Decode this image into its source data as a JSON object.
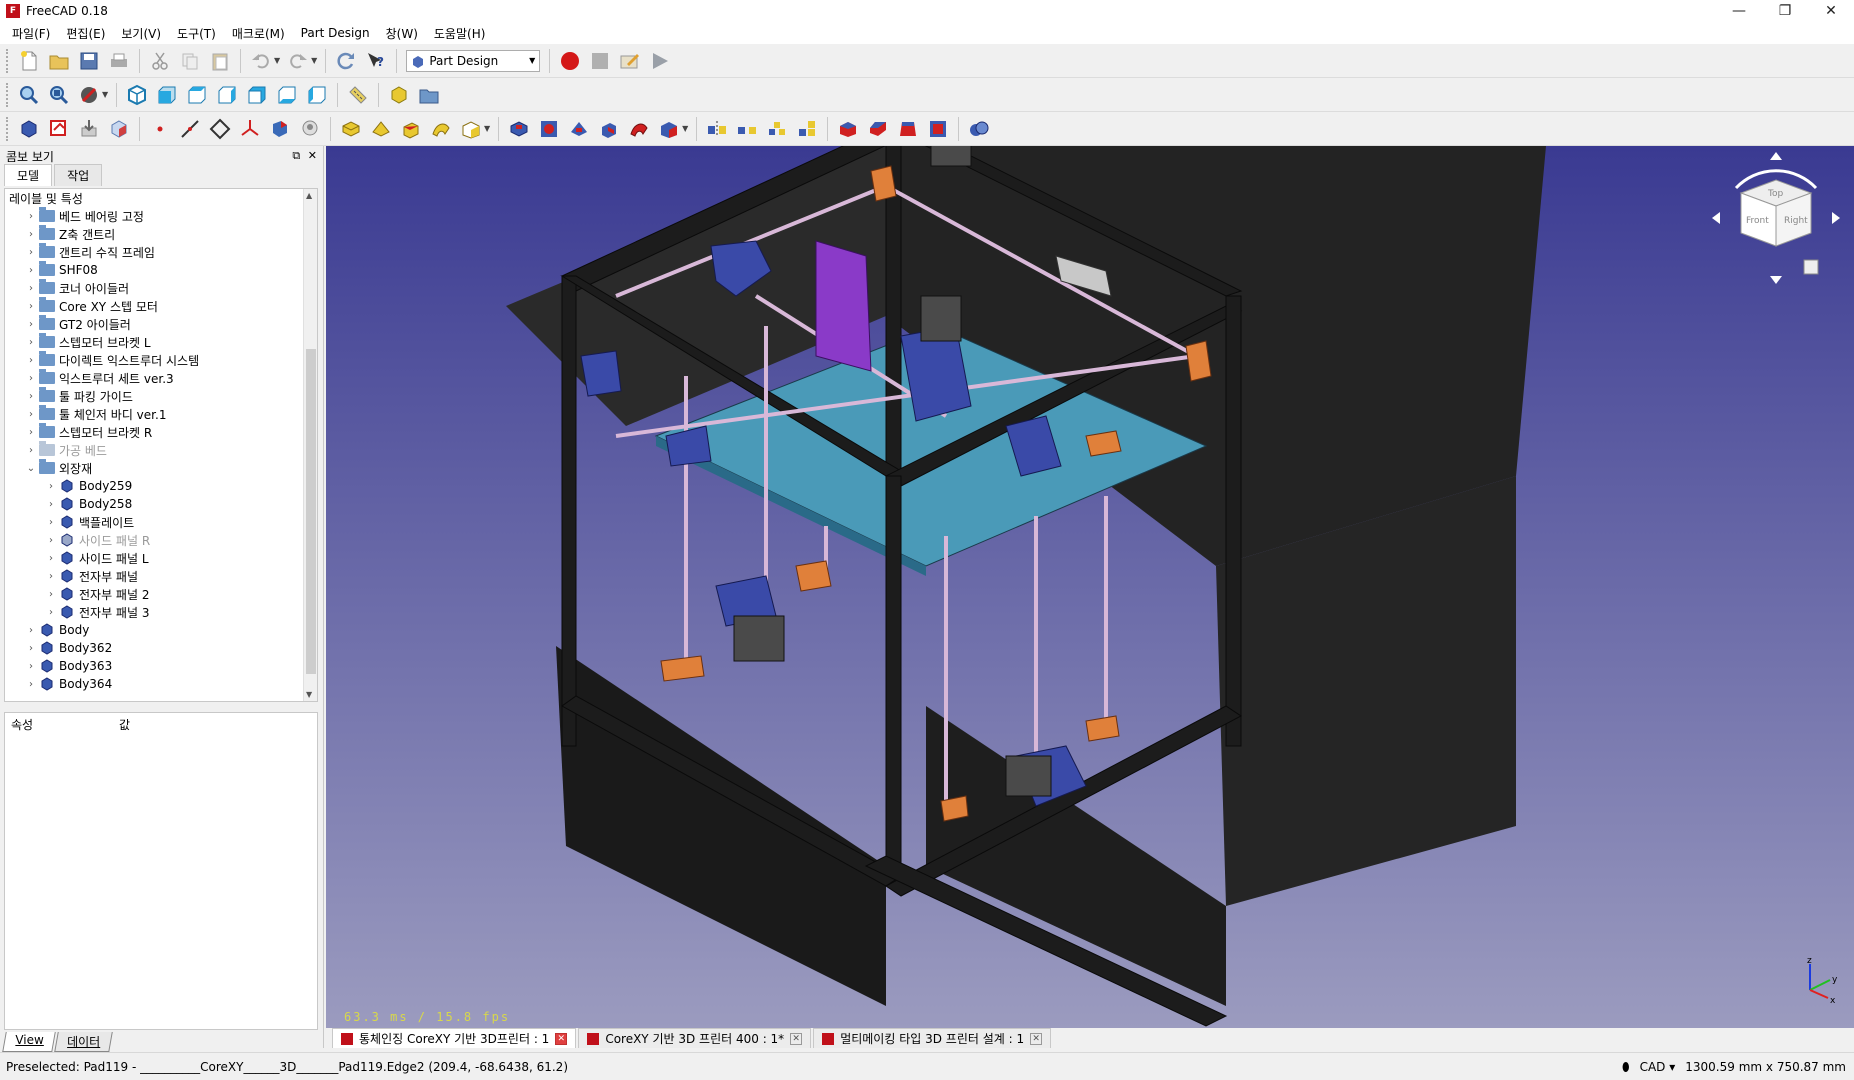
{
  "window": {
    "title": "FreeCAD 0.18",
    "minimize": "—",
    "restore": "❐",
    "close": "✕"
  },
  "menu": [
    "파일(F)",
    "편집(E)",
    "보기(V)",
    "도구(T)",
    "매크로(M)",
    "Part Design",
    "창(W)",
    "도움말(H)"
  ],
  "workbench": {
    "selected": "Part Design"
  },
  "combo": {
    "title": "콤보 보기",
    "tabs": [
      "모델",
      "작업"
    ],
    "tree_header": "레이블 및 특성",
    "items": [
      {
        "label": "베드 베어링 고정",
        "type": "folder",
        "expanded": false,
        "dim": false
      },
      {
        "label": "Z축 갠트리",
        "type": "folder",
        "expanded": false,
        "dim": false
      },
      {
        "label": "갠트리 수직 프레임",
        "type": "folder",
        "expanded": false,
        "dim": false
      },
      {
        "label": "SHF08",
        "type": "folder",
        "expanded": false,
        "dim": false
      },
      {
        "label": "코너 아이들러",
        "type": "folder",
        "expanded": false,
        "dim": false
      },
      {
        "label": "Core XY 스텝 모터",
        "type": "folder",
        "expanded": false,
        "dim": false
      },
      {
        "label": "GT2 아이들러",
        "type": "folder",
        "expanded": false,
        "dim": false
      },
      {
        "label": "스텝모터 브라켓 L",
        "type": "folder-special",
        "expanded": false,
        "dim": false
      },
      {
        "label": "다이렉트 익스트루더 시스템",
        "type": "folder",
        "expanded": false,
        "dim": false
      },
      {
        "label": "익스트루더 세트 ver.3",
        "type": "folder",
        "expanded": false,
        "dim": false
      },
      {
        "label": "툴 파킹 가이드",
        "type": "folder",
        "expanded": false,
        "dim": false
      },
      {
        "label": "툴 체인저 바디 ver.1",
        "type": "folder",
        "expanded": false,
        "dim": false
      },
      {
        "label": "스텝모터 브라켓 R",
        "type": "folder",
        "expanded": false,
        "dim": false
      },
      {
        "label": "가공 베드",
        "type": "folder",
        "expanded": false,
        "dim": true
      },
      {
        "label": "외장재",
        "type": "folder",
        "expanded": true,
        "dim": false
      },
      {
        "label": "Body259",
        "type": "body",
        "child": true,
        "dim": false
      },
      {
        "label": "Body258",
        "type": "body",
        "child": true,
        "dim": false
      },
      {
        "label": "백플레이트",
        "type": "body",
        "child": true,
        "dim": false
      },
      {
        "label": "사이드 패널 R",
        "type": "body",
        "child": true,
        "dim": true
      },
      {
        "label": "사이드 패널 L",
        "type": "body",
        "child": true,
        "dim": false
      },
      {
        "label": "전자부 패널",
        "type": "body",
        "child": true,
        "dim": false
      },
      {
        "label": "전자부 패널 2",
        "type": "body",
        "child": true,
        "dim": false
      },
      {
        "label": "전자부 패널 3",
        "type": "body",
        "child": true,
        "dim": false
      },
      {
        "label": "Body",
        "type": "body",
        "dim": false
      },
      {
        "label": "Body362",
        "type": "body",
        "dim": false
      },
      {
        "label": "Body363",
        "type": "body",
        "dim": false
      },
      {
        "label": "Body364",
        "type": "body",
        "dim": false
      }
    ],
    "props_headers": [
      "속성",
      "값"
    ],
    "bottom_tabs": [
      "View",
      "데이터"
    ]
  },
  "view3d": {
    "fps": "63.3 ms / 15.8 fps",
    "navcube_faces": [
      "Top",
      "Front",
      "Right"
    ],
    "axis_labels": [
      "z",
      "y",
      "x"
    ]
  },
  "doc_tabs": [
    {
      "label": "통체인징 CoreXY 기반 3D프린터 : 1",
      "active": true
    },
    {
      "label": "CoreXY 기반 3D 프린터 400 : 1*",
      "active": false
    },
    {
      "label": "멀티메이킹 타입 3D 프린터 설계 : 1",
      "active": false
    }
  ],
  "status": {
    "preselected": "Preselected: Pad119 - __________CoreXY______3D_______Pad119.Edge2 (209.4, -68.6438, 61.2)",
    "nav_style": "CAD",
    "dimensions": "1300.59 mm x 750.87 mm"
  },
  "colors": {
    "frame": "#1c1c1c",
    "bed": "#4a9ab8",
    "blue_parts": "#3a4aa8",
    "orange_parts": "#e0803a",
    "purple_plate": "#8a3ac8",
    "rod": "#d8b8d8",
    "panel": "#232323"
  }
}
